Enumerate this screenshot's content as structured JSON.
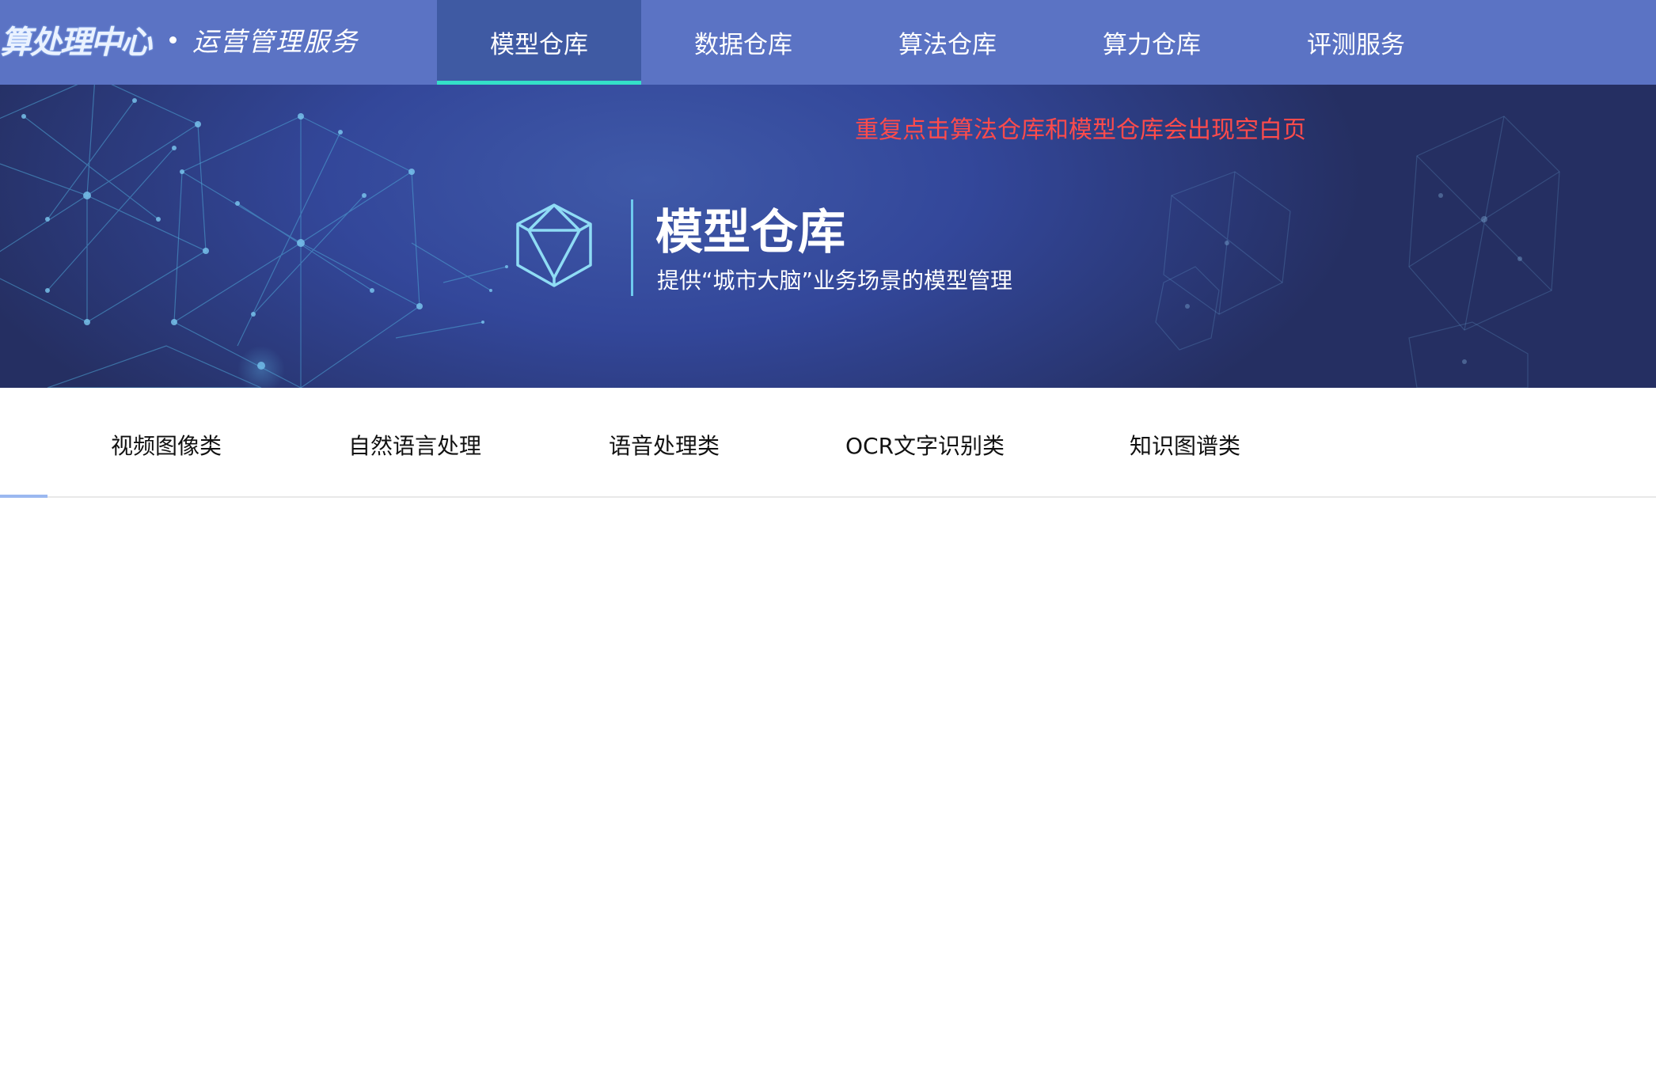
{
  "header": {
    "logo_main": "算处理中心",
    "logo_sub": "运营管理服务",
    "nav": [
      {
        "label": "模型仓库",
        "active": true
      },
      {
        "label": "数据仓库",
        "active": false
      },
      {
        "label": "算法仓库",
        "active": false
      },
      {
        "label": "算力仓库",
        "active": false
      },
      {
        "label": "评测服务",
        "active": false
      }
    ]
  },
  "banner": {
    "notice": "重复点击算法仓库和模型仓库会出现空白页",
    "title": "模型仓库",
    "subtitle": "提供“城市大脑”业务场景的模型管理",
    "icon": "cube-icon"
  },
  "category_tabs": [
    {
      "label": "视频图像类"
    },
    {
      "label": "自然语言处理"
    },
    {
      "label": "语音处理类"
    },
    {
      "label": "OCR文字识别类"
    },
    {
      "label": "知识图谱类"
    }
  ],
  "colors": {
    "navbar": "#5b73c4",
    "nav_active": "#3f5aa3",
    "nav_active_underline": "#34e0c8",
    "notice": "#ff4b4b",
    "tab_indicator": "#9bb8f0"
  }
}
